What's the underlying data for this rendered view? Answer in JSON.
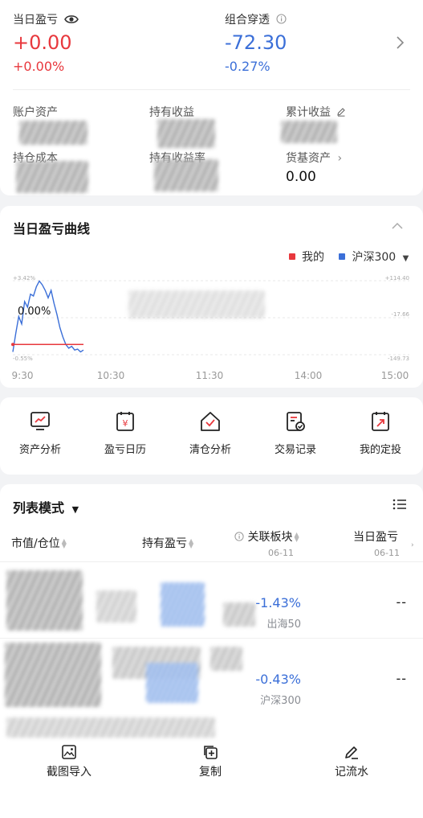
{
  "summary": {
    "today_pl_label": "当日盈亏",
    "today_pl_value": "+0.00",
    "today_pl_pct": "+0.00%",
    "portfolio_label": "组合穿透",
    "portfolio_value": "-72.30",
    "portfolio_pct": "-0.27%",
    "account_assets_label": "账户资产",
    "holding_income_label": "持有收益",
    "cumulative_income_label": "累计收益",
    "holding_cost_label": "持仓成本",
    "holding_rate_label": "持有收益率",
    "money_fund_label": "货基资产",
    "money_fund_value": "0.00"
  },
  "chart_section": {
    "title": "当日盈亏曲线",
    "legend_mine": "我的",
    "legend_index": "沪深300",
    "current_label": "0.00%"
  },
  "chart_data": {
    "type": "line",
    "x_ticks": [
      "9:30",
      "10:30",
      "11:30",
      "14:00",
      "15:00"
    ],
    "left_ticks": [
      "+3.42%",
      "-0.55%"
    ],
    "right_ticks": [
      "+114.40",
      "-17.66",
      "-149.73"
    ],
    "ylim_left": [
      -0.55,
      3.42
    ],
    "series": [
      {
        "name": "我的",
        "color": "#e8383d",
        "values": [
          0.0,
          0.0
        ]
      },
      {
        "name": "沪深300",
        "color": "#3b6fd8",
        "values": [
          -0.4,
          0.6,
          1.5,
          1.1,
          2.3,
          2.0,
          2.7,
          2.6,
          3.1,
          3.4,
          3.2,
          2.9,
          2.5,
          2.9,
          2.2,
          1.6,
          0.9,
          0.4,
          0.0,
          -0.2,
          -0.1,
          -0.3,
          -0.25,
          -0.4,
          -0.3
        ]
      }
    ]
  },
  "tools": [
    {
      "label": "资产分析",
      "icon": "chart-monitor-icon"
    },
    {
      "label": "盈亏日历",
      "icon": "yen-calendar-icon"
    },
    {
      "label": "清仓分析",
      "icon": "house-check-icon"
    },
    {
      "label": "交易记录",
      "icon": "document-check-icon"
    },
    {
      "label": "我的定投",
      "icon": "calendar-arrow-icon"
    }
  ],
  "list": {
    "mode_label": "列表模式",
    "col_market": "市值/仓位",
    "col_holding": "持有盈亏",
    "col_sector": "关联板块",
    "col_sector_date": "06-11",
    "col_today": "当日盈亏",
    "col_today_date": "06-11",
    "rows": [
      {
        "sector_pct": "-1.43%",
        "sector_name": "出海50",
        "today": "--"
      },
      {
        "sector_pct": "-0.43%",
        "sector_name": "沪深300",
        "today": "--"
      }
    ]
  },
  "bottom_actions": [
    {
      "label": "截图导入"
    },
    {
      "label": "复制"
    },
    {
      "label": "记流水"
    }
  ],
  "colors": {
    "up": "#e8383d",
    "down": "#3b6fd8"
  }
}
